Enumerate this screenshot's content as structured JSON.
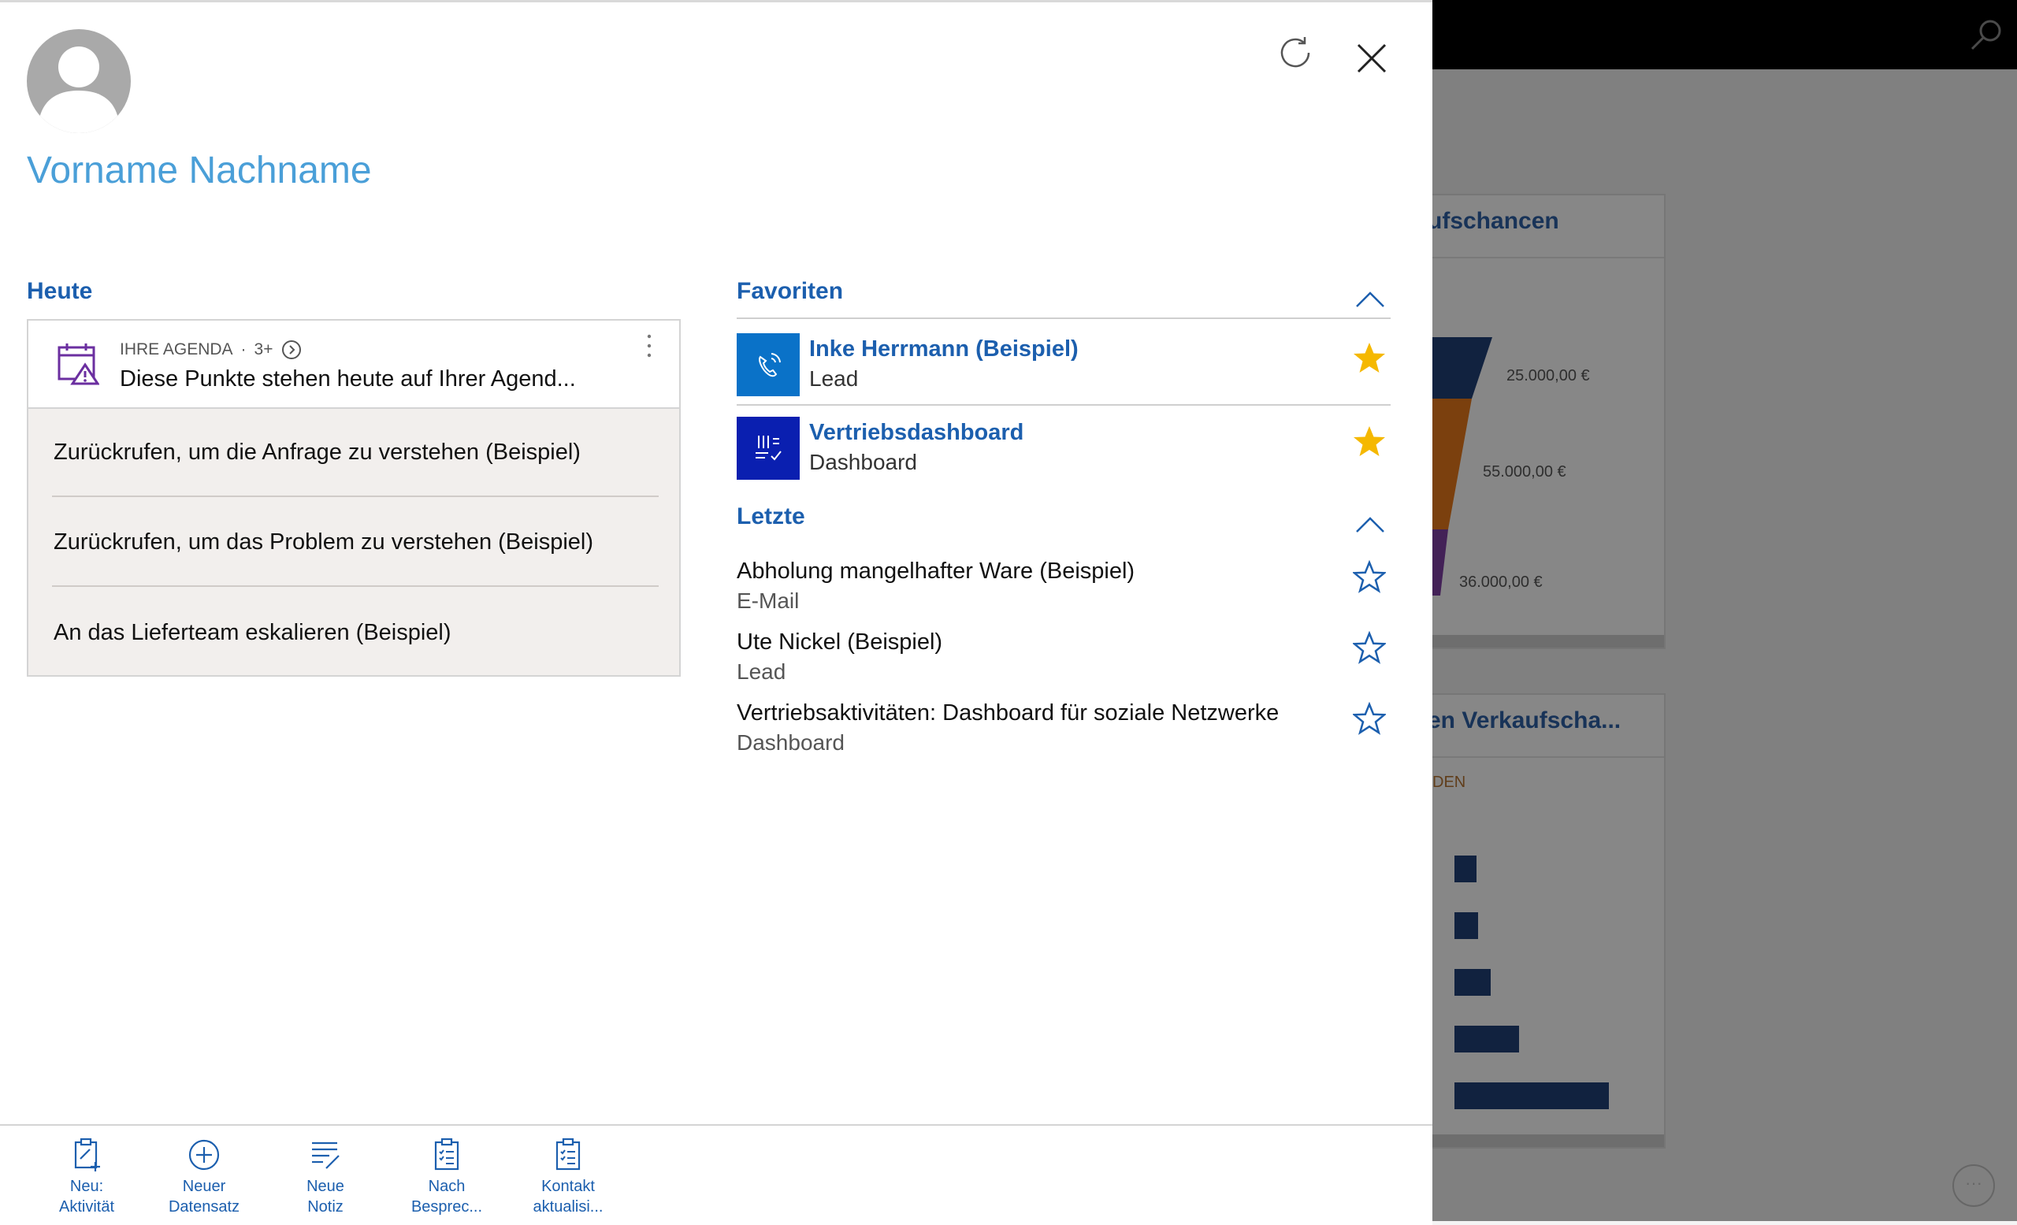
{
  "background": {
    "card1_title": "ufschancen",
    "card2_title": "en Verkaufscha...",
    "card2_subtitle": "DEN",
    "funnel_values": [
      "25.000,00 €",
      "55.000,00 €",
      "36.000,00 €"
    ]
  },
  "header": {
    "user_name": "Vorname Nachname"
  },
  "today": {
    "title": "Heute",
    "agenda_label": "IHRE AGENDA",
    "agenda_count": "3+",
    "agenda_summary": "Diese Punkte stehen heute auf Ihrer Agend...",
    "items": [
      {
        "label": "Zurückrufen, um die Anfrage zu verstehen (Beispiel)"
      },
      {
        "label": "Zurückrufen, um das Problem zu verstehen (Beispiel)"
      },
      {
        "label": "An das Lieferteam eskalieren (Beispiel)"
      }
    ]
  },
  "favorites": {
    "title": "Favoriten",
    "items": [
      {
        "name": "Inke Herrmann (Beispiel)",
        "type": "Lead",
        "tile_color": "#0a72c8",
        "icon": "phone-icon"
      },
      {
        "name": "Vertriebsdashboard",
        "type": "Dashboard",
        "tile_color": "#0a1fb0",
        "icon": "dashboard-icon"
      }
    ]
  },
  "recent": {
    "title": "Letzte",
    "items": [
      {
        "name": "Abholung mangelhafter Ware (Beispiel)",
        "type": "E-Mail"
      },
      {
        "name": "Ute Nickel (Beispiel)",
        "type": "Lead"
      },
      {
        "name": "Vertriebsaktivitäten: Dashboard für soziale Netzwerke",
        "type": "Dashboard"
      }
    ]
  },
  "commands": [
    {
      "line1": "Neu:",
      "line2": "Aktivität",
      "icon": "new-activity-icon"
    },
    {
      "line1": "Neuer",
      "line2": "Datensatz",
      "icon": "new-record-icon"
    },
    {
      "line1": "Neue",
      "line2": "Notiz",
      "icon": "new-note-icon"
    },
    {
      "line1": "Nach",
      "line2": "Besprec...",
      "icon": "after-meeting-icon"
    },
    {
      "line1": "Kontakt",
      "line2": "aktualisi...",
      "icon": "update-contact-icon"
    }
  ],
  "colors": {
    "accent": "#1c5fae",
    "name_blue": "#4a9fd8",
    "star_filled": "#f5b800",
    "agenda_icon": "#6b2fa0"
  }
}
